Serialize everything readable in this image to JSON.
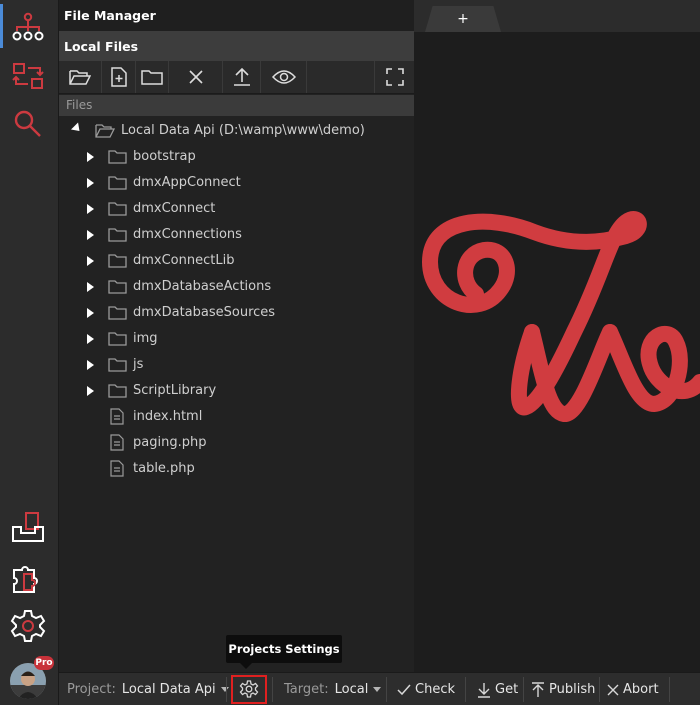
{
  "panel": {
    "title": "File Manager",
    "subtitle": "Local Files",
    "files_header": "Files"
  },
  "tree": {
    "root": "Local Data Api (D:\\wamp\\www\\demo)",
    "folders": [
      "bootstrap",
      "dmxAppConnect",
      "dmxConnect",
      "dmxConnections",
      "dmxConnectLib",
      "dmxDatabaseActions",
      "dmxDatabaseSources",
      "img",
      "js",
      "ScriptLibrary"
    ],
    "files": [
      "index.html",
      "paging.php",
      "table.php"
    ]
  },
  "tabs": {
    "new_tab": "+"
  },
  "tooltip": "Projects Settings",
  "user": {
    "badge": "Pro"
  },
  "statusbar": {
    "project_label": "Project:",
    "project_value": "Local Data Api",
    "target_label": "Target:",
    "target_value": "Local",
    "check": "Check",
    "get": "Get",
    "publish": "Publish",
    "abort": "Abort"
  },
  "icons": {
    "activity": [
      "sitemap-icon",
      "sync-arrows-icon",
      "search-icon",
      "inbox-icon",
      "extensions-icon",
      "gear-icon"
    ],
    "toolbar": [
      "open-folder-icon",
      "new-file-icon",
      "new-folder-icon",
      "delete-icon",
      "upload-icon",
      "preview-icon",
      "fullscreen-icon"
    ]
  },
  "colors": {
    "accent": "#c8323a",
    "logo": "#d03c40",
    "active_indicator": "#4b8bd8"
  }
}
